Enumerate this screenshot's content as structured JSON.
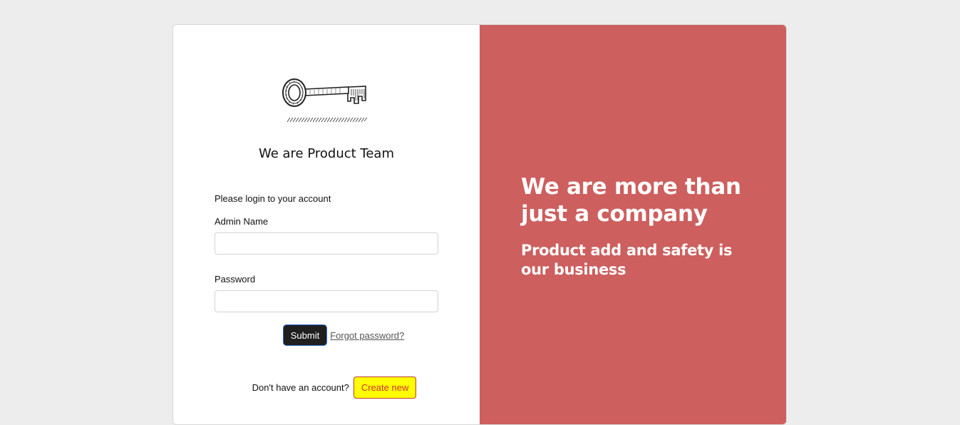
{
  "brand": {
    "logo_icon": "key-icon",
    "team_title": "We are Product Team"
  },
  "login": {
    "prompt": "Please login to your account",
    "admin_label": "Admin Name",
    "admin_value": "",
    "password_label": "Password",
    "password_value": "",
    "submit_label": "Submit",
    "forgot_label": "Forgot password?"
  },
  "signup": {
    "text": "Don't have an account?",
    "button_label": "Create new"
  },
  "hero": {
    "headline": "We are more than just a company",
    "subline": "Product add and safety is our business"
  },
  "colors": {
    "page_background": "#ededed",
    "hero_background": "#cd5f5e",
    "submit_background": "#1f1f1f",
    "create_background": "#ffff00",
    "create_text": "#cc3333"
  }
}
